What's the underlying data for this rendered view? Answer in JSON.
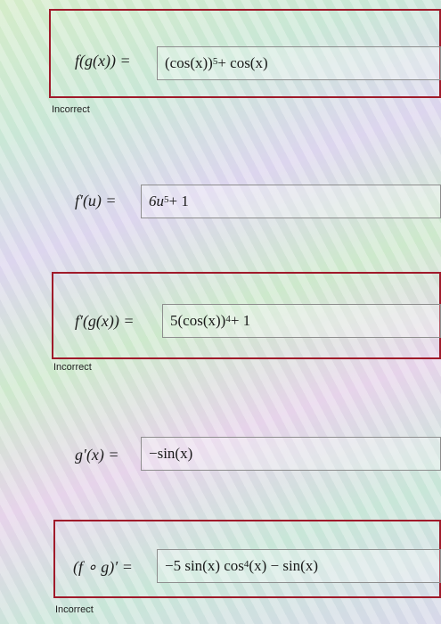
{
  "rows": [
    {
      "label": "f(g(x)) =",
      "answer_pre": "(cos(x))",
      "answer_sup": "5",
      "answer_post": " + cos(x)",
      "status": "Incorrect"
    },
    {
      "label": "f′(u) =",
      "answer_pre": "6u",
      "answer_sup": "5",
      "answer_post": " + 1"
    },
    {
      "label": "f′(g(x)) =",
      "answer_pre": "5(cos(x))",
      "answer_sup": "4",
      "answer_post": " + 1",
      "status": "Incorrect"
    },
    {
      "label": "g′(x) =",
      "answer_pre": "−sin(x)",
      "answer_sup": "",
      "answer_post": ""
    },
    {
      "label": "(f ∘ g)′ =",
      "answer_pre": "−5 sin(x) cos",
      "answer_sup": "4",
      "answer_post": "(x) − sin(x)",
      "status": "Incorrect"
    }
  ],
  "colors": {
    "incorrect_border": "#a01a2a",
    "field_border": "#8e8e8e"
  }
}
